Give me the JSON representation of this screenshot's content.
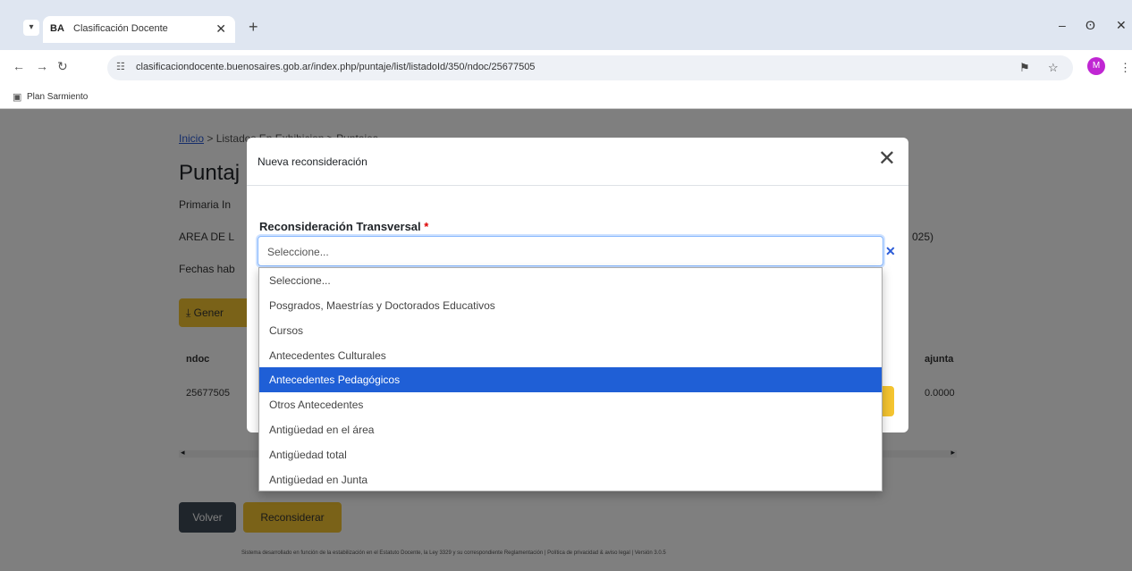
{
  "browser": {
    "tab_menu": "▾",
    "tab_favicon": "BA",
    "tab_title": "Clasificación Docente",
    "tab_close": "✕",
    "new_tab": "+",
    "minimize": "–",
    "restore": "ʘ",
    "close": "✕",
    "back": "←",
    "forward": "→",
    "reload": "↻",
    "site_info": "☷",
    "url": "clasificaciondocente.buenosaires.gob.ar/index.php/puntaje/list/listadoId/350/ndoc/25677505",
    "translate": "⚑",
    "bookmark_star": "☆",
    "profile_initial": "M",
    "menu": "⋮",
    "bookmark_icon": "▣",
    "bookmark_label": "Plan Sarmiento"
  },
  "page": {
    "breadcrumb_home": "Inicio",
    "breadcrumb_sep": ">",
    "breadcrumb_rest": "Listados En Exhibicion > Puntajes",
    "title": "Puntaj",
    "info1": "Primaria In",
    "info2": "AREA DE L",
    "info2_right": "025)",
    "info3": "Fechas hab",
    "generate_button": "⤓ Gener",
    "col_ndoc": "ndoc",
    "col_ajunta": "ajunta",
    "row_ndoc": "25677505",
    "row_ajunta": "0.0000",
    "scroll_left": "◂",
    "scroll_right": "▸",
    "volver_button": "Volver",
    "reconsiderar_button": "Reconsiderar",
    "footer": "Sistema desarrollado en función de la estabilización en el Estatuto Docente, la Ley 3329 y su correspondiente Reglamentación | Política de privacidad & aviso legal | Versión 3.0.5"
  },
  "modal": {
    "title": "Nueva reconsideración",
    "close": "✕",
    "field_label": "Reconsideración Transversal",
    "required_mark": "*",
    "select_value": "Seleccione...",
    "clear": "✕",
    "options": [
      "Seleccione...",
      "Posgrados, Maestrías y Doctorados Educativos",
      "Cursos",
      "Antecedentes Culturales",
      "Antecedentes Pedagógicos",
      "Otros Antecedentes",
      "Antigüedad en el área",
      "Antigüedad total",
      "Antigüedad en Junta"
    ],
    "highlighted_option": "Antecedentes Pedagógicos",
    "highlight_color": "#1f5fd6"
  }
}
